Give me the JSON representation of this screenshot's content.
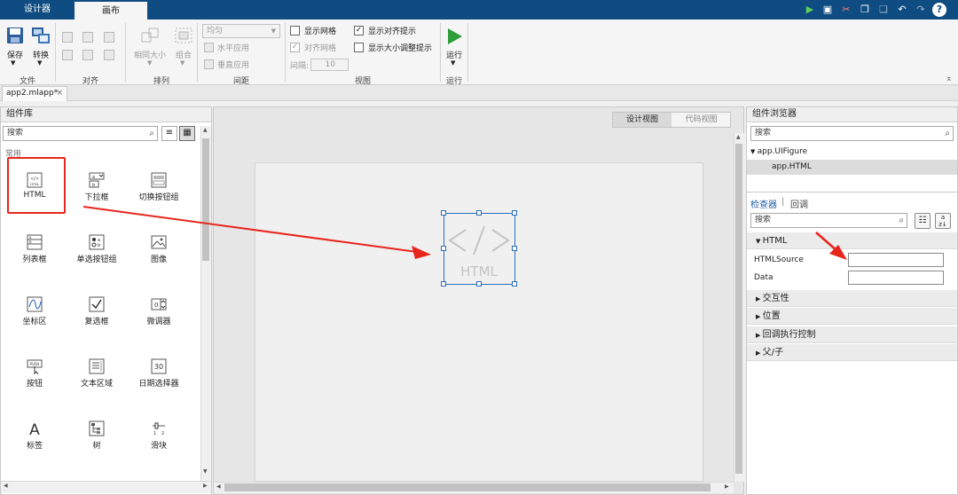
{
  "ribbon_tabs": [
    "设计器",
    "画布"
  ],
  "ribbon": {
    "file": {
      "save": "保存",
      "convert": "转换",
      "group": "文件"
    },
    "align": {
      "group": "对齐"
    },
    "arrange": {
      "same_size": "相同大小",
      "group_btn": "组合",
      "group": "排列"
    },
    "spacing": {
      "dropdown": "均匀",
      "horizontal": "水平应用",
      "vertical": "垂直应用",
      "gap_label": "间隔:",
      "gap_value": "10",
      "group": "间距"
    },
    "view": {
      "show_grid": "显示网格",
      "snap_grid": "对齐网格",
      "show_align": "显示对齐提示",
      "show_resize": "显示大小调整提示",
      "group": "视图"
    },
    "run": {
      "label": "运行",
      "group": "运行"
    }
  },
  "doc_tab": "app2.mlapp*",
  "library": {
    "title": "组件库",
    "search_placeholder": "搜索",
    "section": "常用",
    "items": [
      {
        "label": "HTML",
        "icon": "html-icon"
      },
      {
        "label": "下拉框",
        "icon": "dropdown-icon"
      },
      {
        "label": "切换按钮组",
        "icon": "toggle-button-group-icon"
      },
      {
        "label": "列表框",
        "icon": "listbox-icon"
      },
      {
        "label": "单选按钮组",
        "icon": "radio-group-icon"
      },
      {
        "label": "图像",
        "icon": "image-icon"
      },
      {
        "label": "坐标区",
        "icon": "axes-icon"
      },
      {
        "label": "复选框",
        "icon": "checkbox-icon"
      },
      {
        "label": "微调器",
        "icon": "spinner-icon"
      },
      {
        "label": "按钮",
        "icon": "push-button-icon"
      },
      {
        "label": "文本区域",
        "icon": "text-area-icon"
      },
      {
        "label": "日期选择器",
        "icon": "date-picker-icon"
      },
      {
        "label": "标签",
        "icon": "label-icon"
      },
      {
        "label": "树",
        "icon": "tree-icon"
      },
      {
        "label": "滑块",
        "icon": "slider-icon"
      }
    ]
  },
  "canvas": {
    "design_view": "设计视图",
    "code_view": "代码视图",
    "html_component_text": "HTML"
  },
  "browser": {
    "title": "组件浏览器",
    "search_placeholder": "搜索",
    "tree_root": "app.UIFigure",
    "tree_child": "app.HTML",
    "tabs": [
      "检查器",
      "回调"
    ],
    "inspector_search": "搜索",
    "sections": [
      "HTML",
      "交互性",
      "位置",
      "回调执行控制",
      "父/子"
    ],
    "props": [
      {
        "label": "HTMLSource",
        "value": ""
      },
      {
        "label": "Data",
        "value": ""
      }
    ]
  },
  "colors": {
    "titlebar": "#0f4c81",
    "selection": "#2a6ebb",
    "annotation": "#e8251c",
    "run_green": "#2e9e3a"
  }
}
